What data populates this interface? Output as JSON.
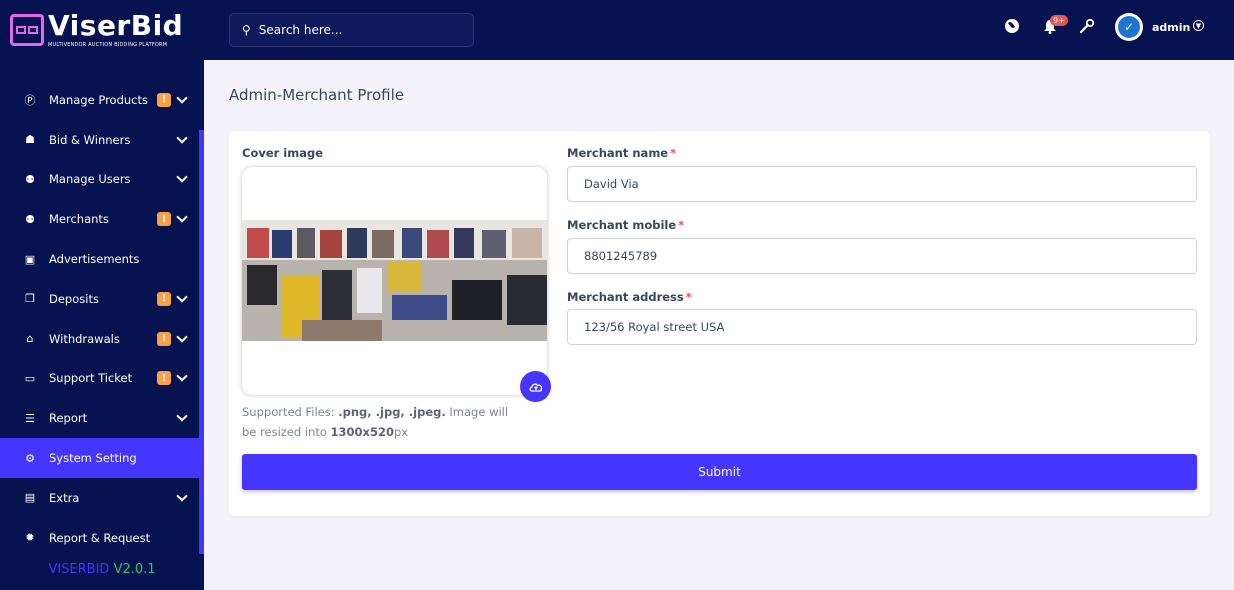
{
  "brand": {
    "title": "ViserBid",
    "subtitle": "MULTIVENDOR AUCTION BIDDING PLATFORM",
    "version_name": "VISERBID",
    "version_number": "V2.0.1"
  },
  "search": {
    "placeholder": "Search here..."
  },
  "header": {
    "notification_count": "9+",
    "user_name": "admin"
  },
  "sidebar": {
    "items": [
      {
        "label": "Manage Products",
        "icon": "product-icon",
        "badge": "!",
        "dropdown": true
      },
      {
        "label": "Bid & Winners",
        "icon": "trophy-icon",
        "badge": "",
        "dropdown": true
      },
      {
        "label": "Manage Users",
        "icon": "users-icon",
        "badge": "",
        "dropdown": true
      },
      {
        "label": "Merchants",
        "icon": "merchants-icon",
        "badge": "!",
        "dropdown": true
      },
      {
        "label": "Advertisements",
        "icon": "ad-icon",
        "badge": "",
        "dropdown": false
      },
      {
        "label": "Deposits",
        "icon": "deposit-icon",
        "badge": "!",
        "dropdown": true
      },
      {
        "label": "Withdrawals",
        "icon": "bank-icon",
        "badge": "!",
        "dropdown": true
      },
      {
        "label": "Support Ticket",
        "icon": "ticket-icon",
        "badge": "!",
        "dropdown": true
      },
      {
        "label": "Report",
        "icon": "list-icon",
        "badge": "",
        "dropdown": true
      },
      {
        "label": "System Setting",
        "icon": "gear-icon",
        "badge": "",
        "dropdown": false,
        "active": true
      },
      {
        "label": "Extra",
        "icon": "server-icon",
        "badge": "",
        "dropdown": true
      },
      {
        "label": "Report & Request",
        "icon": "bug-icon",
        "badge": "",
        "dropdown": false
      }
    ]
  },
  "page": {
    "title": "Admin-Merchant Profile",
    "cover_label": "Cover image",
    "supported_prefix": "Supported Files: ",
    "supported_types": ".png, .jpg, .jpeg.",
    "supported_middle": " Image will be resized into ",
    "supported_size": "1300x520",
    "supported_suffix": "px",
    "name_label": "Merchant name",
    "name_value": "David Via",
    "mobile_label": "Merchant mobile",
    "mobile_value": "8801245789",
    "address_label": "Merchant address",
    "address_value": "123/56 Royal street USA",
    "submit_label": "Submit",
    "required_mark": "*"
  },
  "colors": {
    "sidebar_bg": "#071251",
    "accent": "#4634ff",
    "warning": "#ff9f43",
    "danger": "#ea5455",
    "success": "#28c76f"
  }
}
